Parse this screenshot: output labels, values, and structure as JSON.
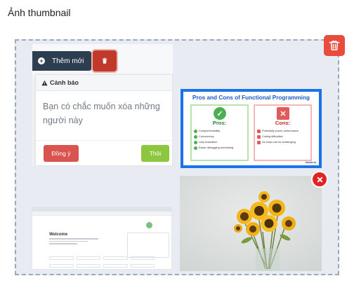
{
  "field": {
    "label": "Ảnh thumbnail"
  },
  "toolbar": {
    "delete_all_icon": "trash-icon"
  },
  "thumbnails": [
    {
      "kind": "screenshot",
      "add_button_label": "Thêm mới",
      "warning": {
        "title": "Cảnh báo",
        "message": "Bạn có chắc muốn xóa những người này",
        "confirm_label": "Đồng ý",
        "cancel_label": "Thôi"
      }
    },
    {
      "kind": "infographic",
      "title": "Pros and Cons of Functional Programming",
      "pros_heading": "Pros:",
      "pros": [
        "Comprehensibility",
        "Concurrency",
        "Lazy evaluation",
        "Easier debugging and testing"
      ],
      "cons_heading": "Cons:",
      "cons": [
        "Potentially poorer performance",
        "Coding difficulties",
        "No loops can be challenging"
      ],
      "brand": "hackr.io"
    },
    {
      "kind": "browser-screenshot",
      "logo_text": "Welcome"
    },
    {
      "kind": "photo",
      "subject": "sunflowers in glass vase",
      "remove_icon": "close-icon",
      "remove_color": "#e02424"
    }
  ],
  "colors": {
    "primary_dark": "#2c3e50",
    "danger": "#d9534f",
    "success": "#8dc63f",
    "focus_border": "#1a73e8"
  }
}
